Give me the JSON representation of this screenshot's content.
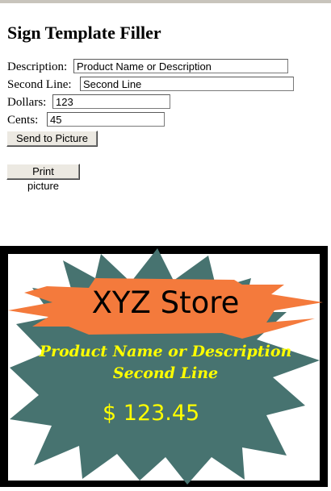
{
  "page": {
    "title": "Sign Template Filler"
  },
  "form": {
    "description_label": "Description:",
    "description_value": "Product Name or Description",
    "second_line_label": "Second Line:",
    "second_line_value": "Second Line",
    "dollars_label": "Dollars:",
    "dollars_value": "123",
    "cents_label": "Cents:",
    "cents_value": "45",
    "send_button": "Send to Picture",
    "print_button": "Print picture"
  },
  "sign": {
    "store_name": "XYZ Store",
    "line1": "Product Name or Description",
    "line2": "Second Line",
    "price": "$ 123.45",
    "colors": {
      "frame": "#000000",
      "starburst": "#477370",
      "banner": "#f47a3c",
      "product_text": "#ffff00",
      "price_text": "#ffff00"
    }
  }
}
